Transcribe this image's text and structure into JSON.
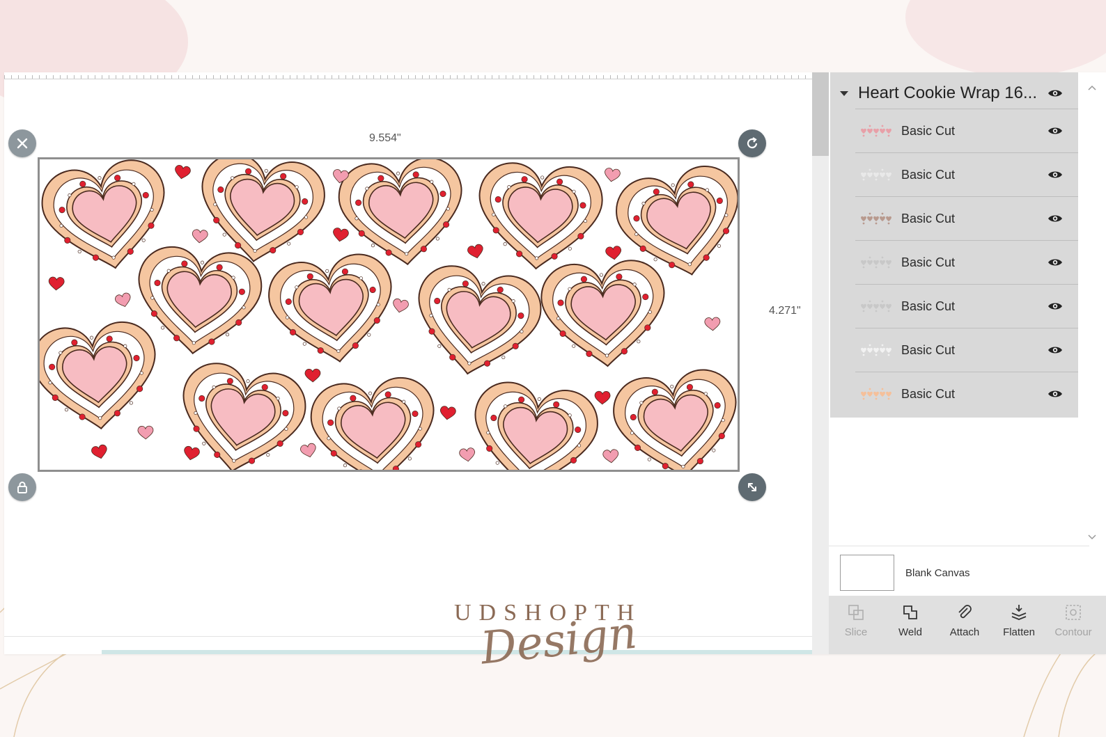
{
  "canvas": {
    "width_label": "9.554\"",
    "height_label": "4.271\""
  },
  "layers": {
    "group_title": "Heart Cookie Wrap 16...",
    "items": [
      {
        "label": "Basic Cut",
        "thumb": "pink-hearts-pattern"
      },
      {
        "label": "Basic Cut",
        "thumb": "light-pattern"
      },
      {
        "label": "Basic Cut",
        "thumb": "brown-outline-pattern"
      },
      {
        "label": "Basic Cut",
        "thumb": "dots-pattern"
      },
      {
        "label": "Basic Cut",
        "thumb": "dots-pattern"
      },
      {
        "label": "Basic Cut",
        "thumb": "white-pattern"
      },
      {
        "label": "Basic Cut",
        "thumb": "peach-pattern"
      }
    ],
    "blank_canvas_label": "Blank Canvas"
  },
  "toolbar": {
    "tools": [
      {
        "label": "Slice",
        "enabled": false,
        "icon": "slice-icon"
      },
      {
        "label": "Weld",
        "enabled": true,
        "icon": "weld-icon"
      },
      {
        "label": "Attach",
        "enabled": true,
        "icon": "paperclip-icon"
      },
      {
        "label": "Flatten",
        "enabled": true,
        "icon": "flatten-icon"
      },
      {
        "label": "Contour",
        "enabled": false,
        "icon": "contour-icon"
      }
    ]
  },
  "watermark": {
    "brand": "UDSHOPTH",
    "script": "Design"
  },
  "colors": {
    "cookie": "#f5c6a0",
    "icing_center": "#f7bcc2",
    "red_heart": "#e02030",
    "pink_heart": "#f29db0",
    "outline": "#4a2a1f"
  }
}
